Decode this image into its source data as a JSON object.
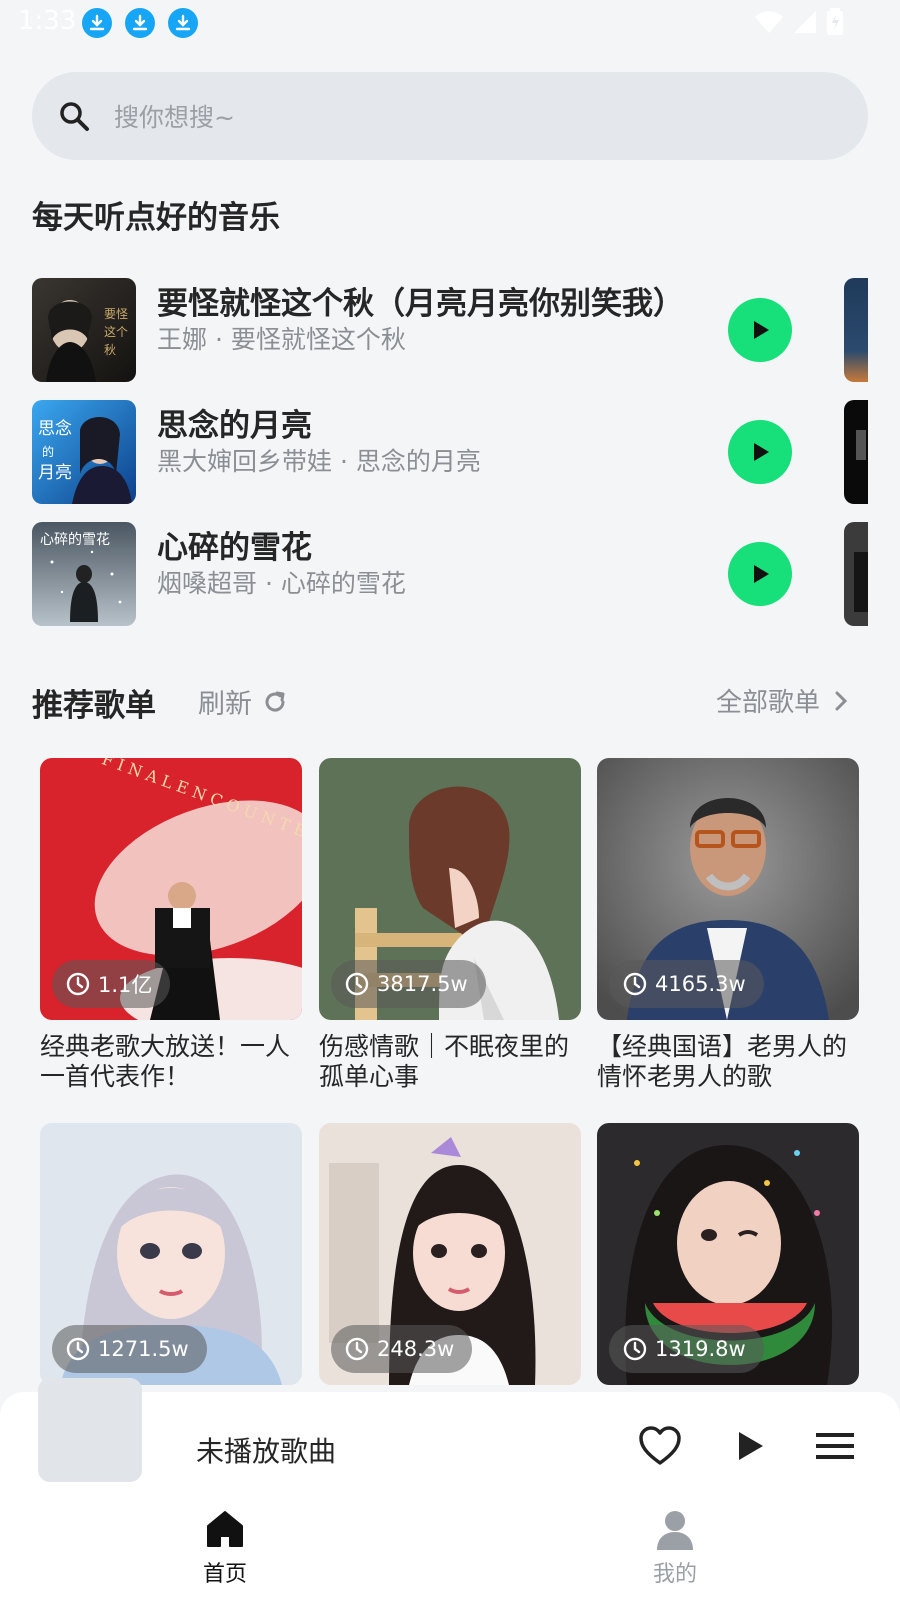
{
  "status_bar": {
    "time": "1:33"
  },
  "search": {
    "placeholder": "搜你想搜~"
  },
  "daily": {
    "title": "每天听点好的音乐",
    "songs": [
      {
        "title": "要怪就怪这个秋（月亮月亮你别笑我）",
        "subtitle": "王娜 · 要怪就怪这个秋"
      },
      {
        "title": "思念的月亮",
        "subtitle": "黑大婶回乡带娃 · 思念的月亮"
      },
      {
        "title": "心碎的雪花",
        "subtitle": "烟嗓超哥 · 心碎的雪花"
      }
    ]
  },
  "playlists": {
    "title": "推荐歌单",
    "refresh_label": "刷新",
    "all_label": "全部歌单",
    "items": [
      {
        "plays": "1.1亿",
        "title": "经典老歌大放送！一人一首代表作！"
      },
      {
        "plays": "3817.5w",
        "title": "伤感情歌｜不眠夜里的孤单心事"
      },
      {
        "plays": "4165.3w",
        "title": "【经典国语】老男人的情怀老男人的歌"
      },
      {
        "plays": "1271.5w",
        "title": ""
      },
      {
        "plays": "248.3w",
        "title": ""
      },
      {
        "plays": "1319.8w",
        "title": ""
      }
    ]
  },
  "player": {
    "title": "未播放歌曲"
  },
  "bottom_nav": {
    "home_label": "首页",
    "mine_label": "我的"
  },
  "colors": {
    "accent_green": "#17e07a",
    "background": "#f3f5f7",
    "download_blue": "#16a6f5"
  },
  "icons": [
    "download-icon",
    "wifi-icon",
    "signal-icon",
    "battery-icon",
    "search-icon",
    "play-icon",
    "refresh-icon",
    "chevron-right-icon",
    "clock-icon",
    "heart-icon",
    "menu-icon",
    "home-icon",
    "user-icon"
  ]
}
